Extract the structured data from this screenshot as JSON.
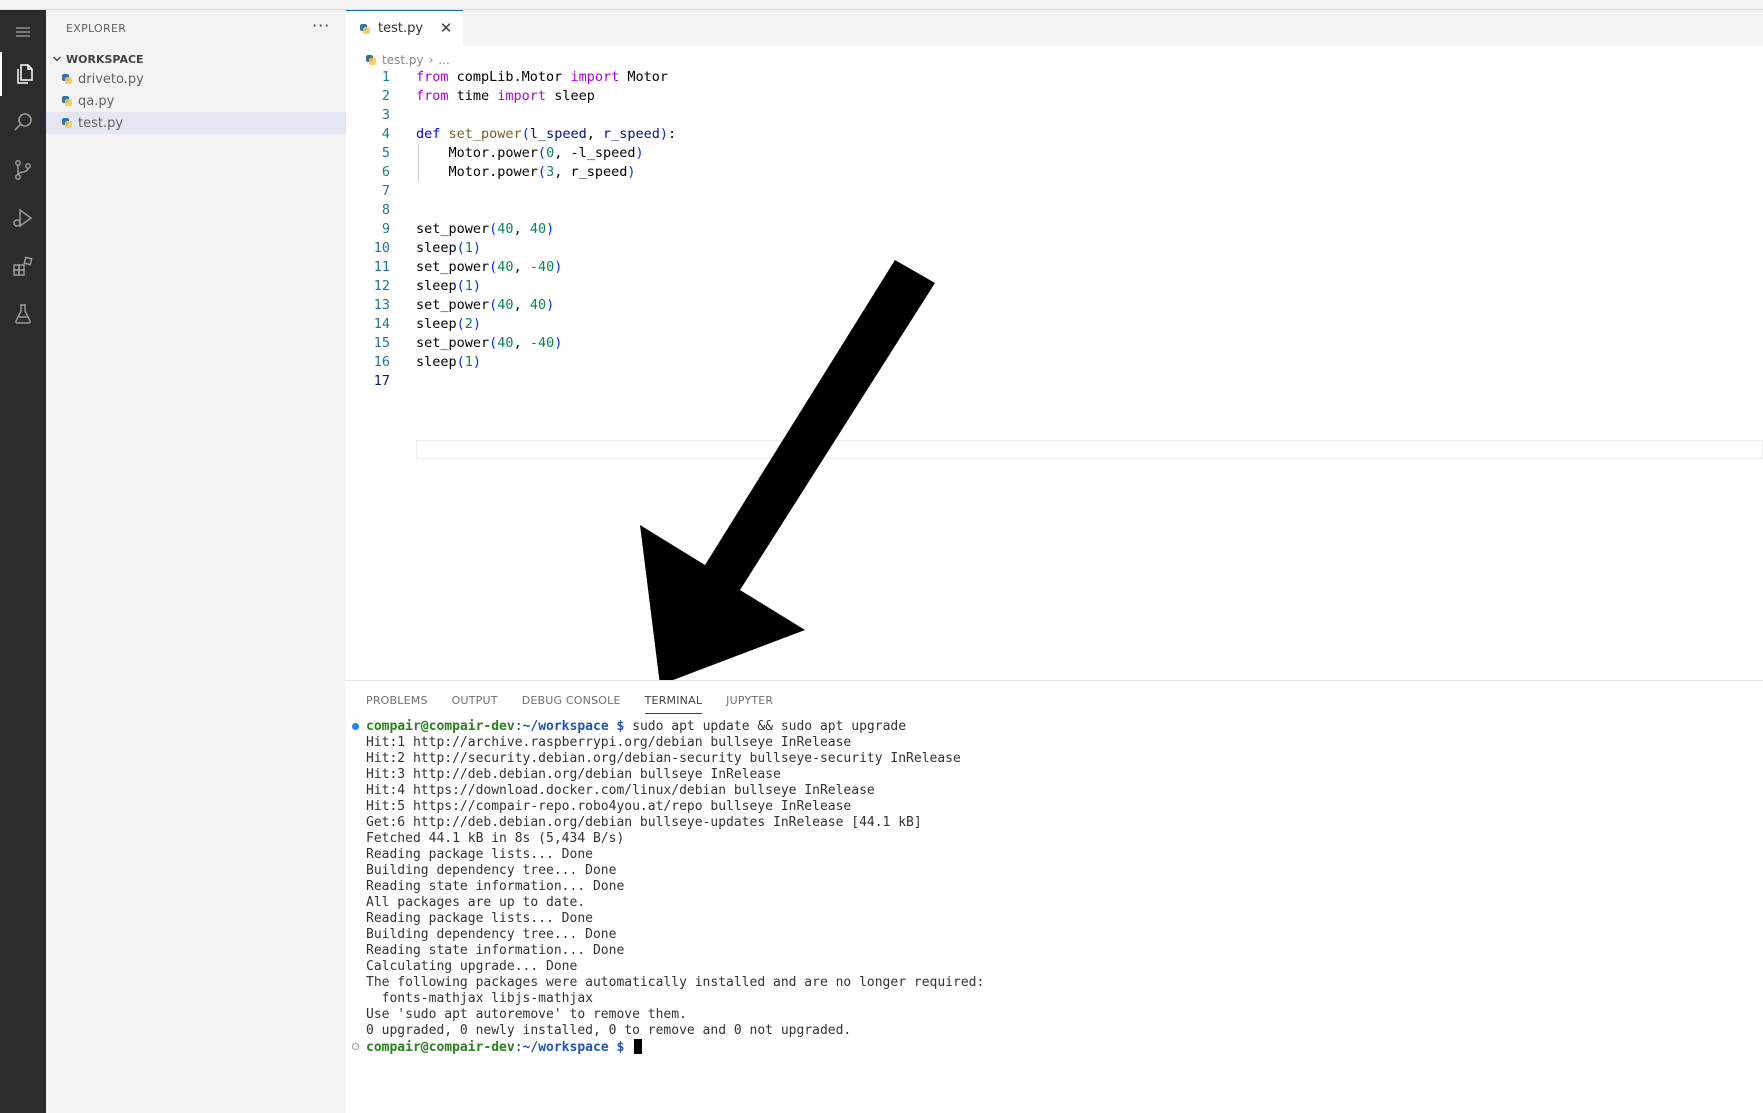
{
  "activity_bar": {
    "items": [
      "menu-icon",
      "explorer-icon",
      "search-icon",
      "source-control-icon",
      "run-debug-icon",
      "extensions-icon",
      "testing-icon"
    ],
    "active": "explorer-icon"
  },
  "sidebar": {
    "title": "EXPLORER",
    "more": "···",
    "workspace": "WORKSPACE",
    "files": [
      {
        "name": "driveto.py"
      },
      {
        "name": "qa.py"
      },
      {
        "name": "test.py",
        "selected": true
      }
    ]
  },
  "editor": {
    "tab_label": "test.py",
    "close_glyph": "✕",
    "breadcrumb": {
      "file": "test.py",
      "sep": "›",
      "rest": "..."
    },
    "lines": [
      {
        "n": "1"
      },
      {
        "n": "2"
      },
      {
        "n": "3"
      },
      {
        "n": "4"
      },
      {
        "n": "5"
      },
      {
        "n": "6"
      },
      {
        "n": "7"
      },
      {
        "n": "8"
      },
      {
        "n": "9"
      },
      {
        "n": "10"
      },
      {
        "n": "11"
      },
      {
        "n": "12"
      },
      {
        "n": "13"
      },
      {
        "n": "14"
      },
      {
        "n": "15"
      },
      {
        "n": "16"
      },
      {
        "n": "17"
      }
    ],
    "code": {
      "l1": {
        "k1": "from",
        "t1": " compLib.Motor ",
        "k2": "import",
        "t2": " Motor"
      },
      "l2": {
        "k1": "from",
        "t1": " time ",
        "k2": "import",
        "t2": " sleep"
      },
      "l4": {
        "def": "def",
        "fn": "set_power",
        "p1": "l_speed",
        "p2": "r_speed"
      },
      "l5": {
        "obj": "Motor.power",
        "a": "0",
        "b": "-l_speed"
      },
      "l6": {
        "obj": "Motor.power",
        "a": "3",
        "b": "r_speed"
      },
      "calls": [
        {
          "fn": "set_power",
          "a": "40",
          "b": "40"
        },
        {
          "fn": "sleep",
          "a": "1"
        },
        {
          "fn": "set_power",
          "a": "40",
          "b": "-40"
        },
        {
          "fn": "sleep",
          "a": "1"
        },
        {
          "fn": "set_power",
          "a": "40",
          "b": "40"
        },
        {
          "fn": "sleep",
          "a": "2"
        },
        {
          "fn": "set_power",
          "a": "40",
          "b": "-40"
        },
        {
          "fn": "sleep",
          "a": "1"
        }
      ]
    },
    "colors": {
      "keyword": "#af00db",
      "def": "#0000ff",
      "function": "#795e26",
      "param": "#001080",
      "number": "#098658"
    }
  },
  "panel": {
    "tabs": [
      "PROBLEMS",
      "OUTPUT",
      "DEBUG CONSOLE",
      "TERMINAL",
      "JUPYTER"
    ],
    "active_tab": "TERMINAL",
    "prompt": {
      "user": "compair@compair-dev",
      "colon": ":",
      "path": "~/workspace",
      "dollar": " $"
    },
    "command": " sudo apt update && sudo apt upgrade",
    "output": [
      "Hit:1 http://archive.raspberrypi.org/debian bullseye InRelease",
      "Hit:2 http://security.debian.org/debian-security bullseye-security InRelease",
      "Hit:3 http://deb.debian.org/debian bullseye InRelease",
      "Hit:4 https://download.docker.com/linux/debian bullseye InRelease",
      "Hit:5 https://compair-repo.robo4you.at/repo bullseye InRelease",
      "Get:6 http://deb.debian.org/debian bullseye-updates InRelease [44.1 kB]",
      "Fetched 44.1 kB in 8s (5,434 B/s)",
      "Reading package lists... Done",
      "Building dependency tree... Done",
      "Reading state information... Done",
      "All packages are up to date.",
      "Reading package lists... Done",
      "Building dependency tree... Done",
      "Reading state information... Done",
      "Calculating upgrade... Done",
      "The following packages were automatically installed and are no longer required:",
      "  fonts-mathjax libjs-mathjax",
      "Use 'sudo apt autoremove' to remove them.",
      "0 upgraded, 0 newly installed, 0 to remove and 0 not upgraded."
    ]
  }
}
